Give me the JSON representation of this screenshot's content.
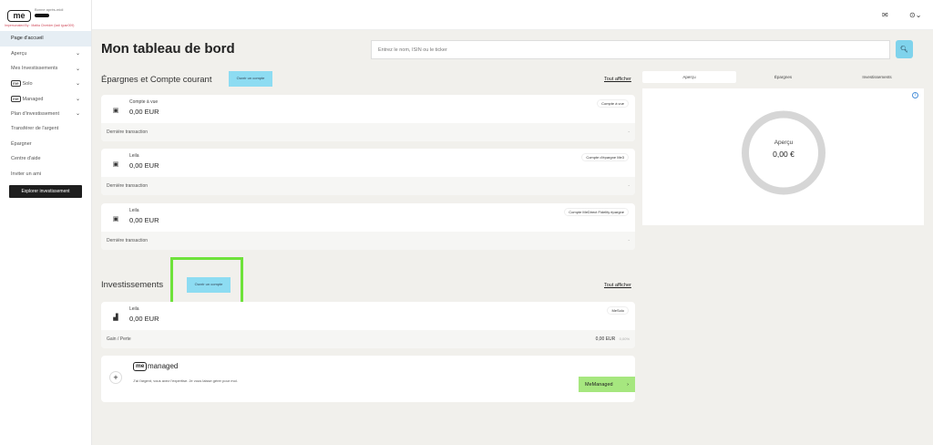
{
  "brand": {
    "logo_text": "me",
    "greeting": "Bonne après-midi",
    "impersonation": "Impersonated By : Mattia Chreider (ladi igusr009)"
  },
  "sidebar": {
    "items": [
      {
        "label": "Page d'accueil",
        "chevron": false,
        "active": true,
        "logo": false
      },
      {
        "label": "Aperçu",
        "chevron": true,
        "logo": false
      },
      {
        "label": "Mes Investissements",
        "chevron": true,
        "logo": false
      },
      {
        "label": "Solo",
        "chevron": true,
        "logo": true
      },
      {
        "label": "Managed",
        "chevron": true,
        "logo": true
      },
      {
        "label": "Plan d'investissement",
        "chevron": true,
        "logo": false
      },
      {
        "label": "Transférer de l'argent",
        "chevron": false,
        "logo": false
      },
      {
        "label": "Épargner",
        "chevron": false,
        "logo": false
      },
      {
        "label": "Centre d'aide",
        "chevron": false,
        "logo": false
      },
      {
        "label": "Inviter un ami",
        "chevron": false,
        "logo": false
      }
    ],
    "explore_button": "Explorer investissement"
  },
  "topbar": {
    "mail_icon": "mail-icon",
    "user_icon": "user-icon"
  },
  "main": {
    "title": "Mon tableau de bord",
    "search_placeholder": "Entrez le nom, ISIN ou le ticker",
    "search_button_icon": "search-icon"
  },
  "savings": {
    "title": "Épargnes et Compte courant",
    "open_button": "Ouvrir un compte",
    "see_all": "Tout afficher",
    "accounts": [
      {
        "name": "Compte à vue",
        "amount": "0,00 EUR",
        "badge": "Compte à vue",
        "foot_label": "Dernière transaction",
        "foot_value": "-"
      },
      {
        "name": "Leila",
        "amount": "0,00 EUR",
        "badge": "Compte d'épargne Me3",
        "foot_label": "Dernière transaction",
        "foot_value": "-"
      },
      {
        "name": "Leila",
        "amount": "0,00 EUR",
        "badge": "Compte MeDirect Fidelity épargne",
        "foot_label": "Dernière transaction",
        "foot_value": "-"
      }
    ]
  },
  "investments": {
    "title": "Investissements",
    "open_button": "Ouvrir un compte",
    "see_all": "Tout afficher",
    "account": {
      "name": "Leila",
      "amount": "0,00 EUR",
      "badge": "MeSolo",
      "foot_label": "Gain / Perte",
      "gain_value": "0,00 EUR",
      "gain_pct": "0,00%"
    },
    "managed": {
      "logo_text": "me",
      "word": "managed",
      "description": "J'ai l'argent, vous avez l'expertise. Je vous laisse gérer pour moi.",
      "button_label": "MeManaged",
      "button_arrow": "›"
    }
  },
  "overview_panel": {
    "tabs": [
      {
        "label": "Aperçu",
        "active": true
      },
      {
        "label": "Épargnes",
        "active": false
      },
      {
        "label": "Investissements",
        "active": false
      }
    ],
    "donut_label": "Aperçu",
    "donut_value": "0,00 €",
    "ring_color": "#d6d6d6"
  }
}
